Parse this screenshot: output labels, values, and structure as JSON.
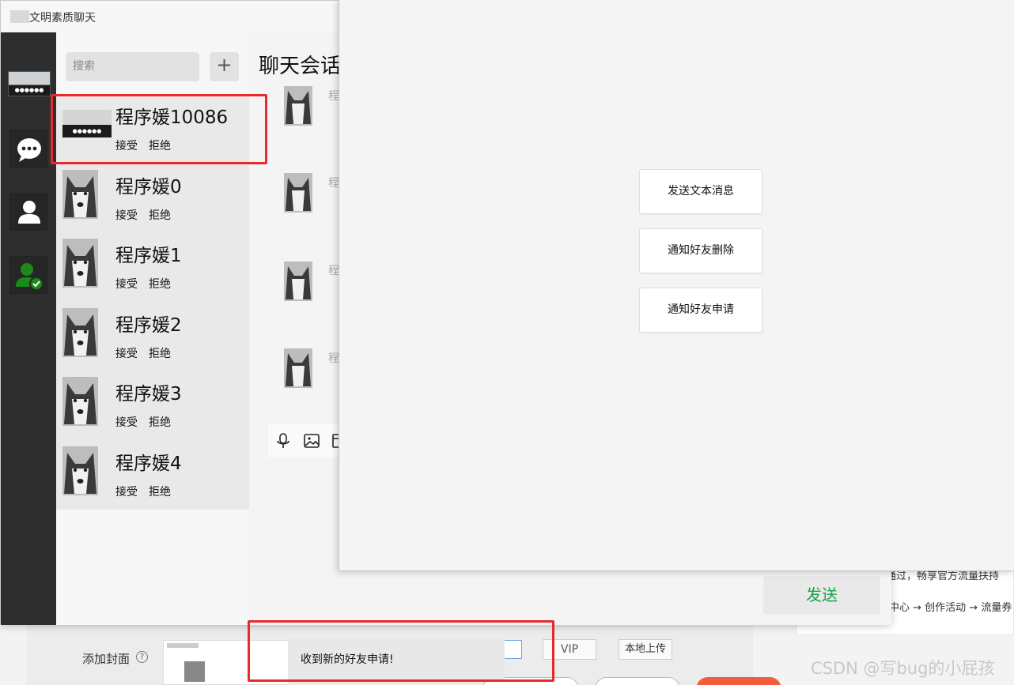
{
  "app": {
    "title": "文明素质聊天"
  },
  "search": {
    "placeholder": "搜索"
  },
  "add_button": "+",
  "contacts": [
    {
      "name": "程序媛10086",
      "accept": "接受",
      "reject": "拒绝",
      "avatar": "group-photo"
    },
    {
      "name": "程序媛0",
      "accept": "接受",
      "reject": "拒绝",
      "avatar": "husky"
    },
    {
      "name": "程序媛1",
      "accept": "接受",
      "reject": "拒绝",
      "avatar": "husky"
    },
    {
      "name": "程序媛2",
      "accept": "接受",
      "reject": "拒绝",
      "avatar": "husky"
    },
    {
      "name": "程序媛3",
      "accept": "接受",
      "reject": "拒绝",
      "avatar": "husky"
    },
    {
      "name": "程序媛4",
      "accept": "接受",
      "reject": "拒绝",
      "avatar": "husky"
    }
  ],
  "chat": {
    "header": "聊天会话",
    "message_name_fragment": "程",
    "send_label": "发送"
  },
  "dialog": {
    "buttons": [
      "发送文本消息",
      "通知好友删除",
      "通知好友申请"
    ]
  },
  "toast": {
    "message": "收到新的好友申请!"
  },
  "background_page": {
    "cover_label": "添加封面",
    "vip_label": "VIP",
    "upload_label": "本地上传",
    "side_text_1": "通过，畅享官方流量扶持",
    "side_text_2": "中心 → 创作活动 → 流量券",
    "watermark": "CSDN @写bug的小屁孩"
  },
  "colors": {
    "highlight": "#e52b2b",
    "send_text": "#1aa34a",
    "rail": "#2e2e2e",
    "new_friend_icon": "#1a8a1a"
  },
  "icons": {
    "rail": [
      "chat-bubble-icon",
      "person-icon",
      "person-add-check-icon"
    ],
    "toolbar": [
      "microphone-icon",
      "image-icon",
      "folder-icon"
    ]
  }
}
